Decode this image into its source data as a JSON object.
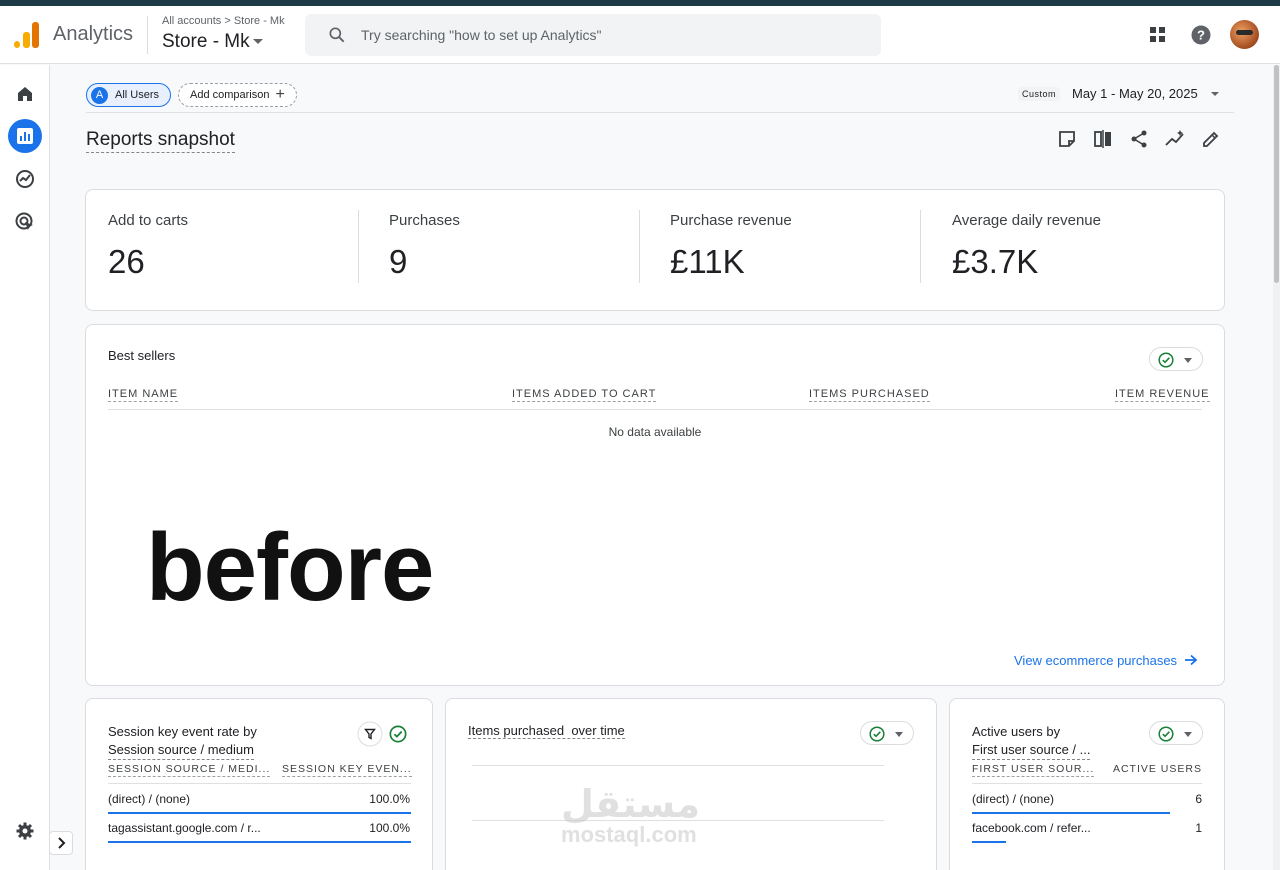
{
  "header": {
    "app_name": "Analytics",
    "breadcrumb": "All accounts > Store - Mk",
    "property": "Store - Mk",
    "search_placeholder": "Try searching \"how to set up Analytics\""
  },
  "toolbar": {
    "all_users": "All Users",
    "all_users_avatar": "A",
    "add_comparison": "Add comparison",
    "custom_label": "Custom",
    "date_range": "May 1 - May 20, 2025"
  },
  "page_title": "Reports snapshot",
  "metrics": [
    {
      "label": "Add to carts",
      "value": "26"
    },
    {
      "label": "Purchases",
      "value": "9"
    },
    {
      "label": "Purchase revenue",
      "value": "£11K"
    },
    {
      "label": "Average daily revenue",
      "value": "£3.7K"
    }
  ],
  "best_sellers": {
    "title": "Best sellers",
    "columns": [
      "ITEM NAME",
      "ITEMS ADDED TO CART",
      "ITEMS PURCHASED",
      "ITEM REVENUE"
    ],
    "empty_text": "No data available",
    "overlay_text": "before",
    "link": "View ecommerce purchases"
  },
  "session_card": {
    "title_line1": "Session key event rate by",
    "title_line2": "Session source / medium",
    "columns": [
      "SESSION SOURCE / MEDI...",
      "SESSION KEY EVEN..."
    ],
    "rows": [
      {
        "source": "(direct) / (none)",
        "value": "100.0%",
        "fraction": 1.0
      },
      {
        "source": "tagassistant.google.com / r...",
        "value": "100.0%",
        "fraction": 1.0
      }
    ]
  },
  "items_card": {
    "title": "Items purchased  over time"
  },
  "active_card": {
    "title_line1": "Active users by",
    "title_line2": "First user source / ...",
    "columns": [
      "FIRST USER SOUR...",
      "ACTIVE USERS"
    ],
    "rows": [
      {
        "source": "(direct) / (none)",
        "value": "6",
        "fraction": 1.0
      },
      {
        "source": "facebook.com / refer...",
        "value": "1",
        "fraction": 0.17
      }
    ]
  },
  "watermark": {
    "arabic": "مستقل",
    "latin": "mostaql.com"
  },
  "colors": {
    "accent": "#1a73e8",
    "success": "#188038",
    "logo_orange": "#f9ab00",
    "logo_dark_orange": "#e37400"
  }
}
